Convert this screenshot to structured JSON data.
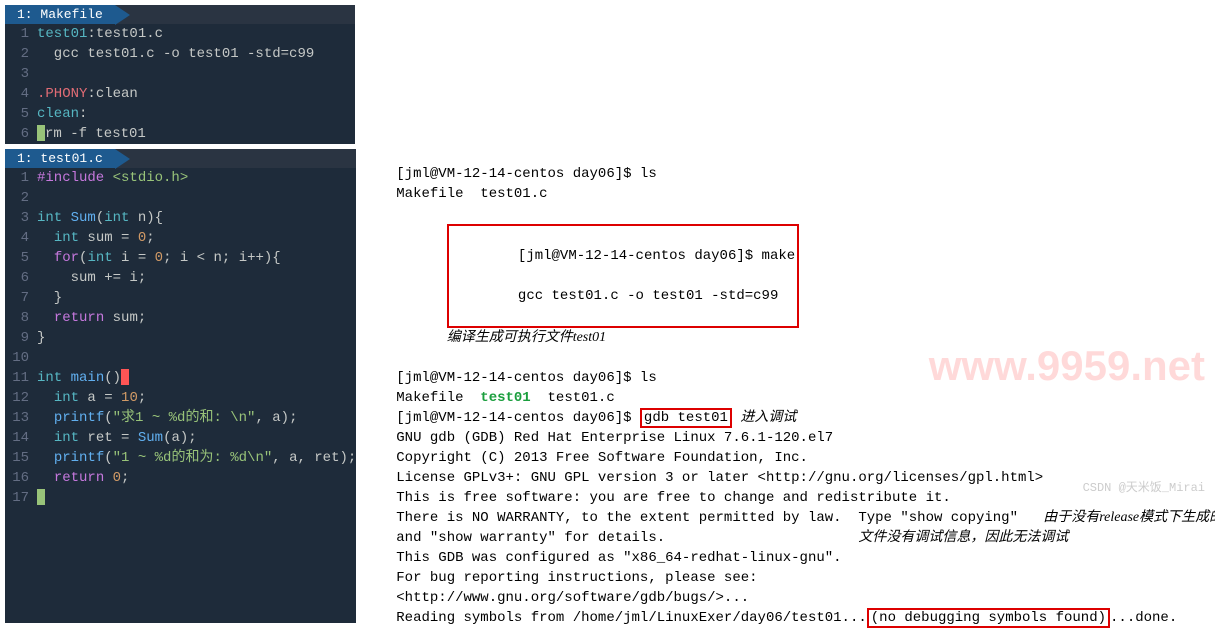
{
  "editor1": {
    "tab": "1: Makefile",
    "lines": [
      {
        "n": "1",
        "seg": [
          {
            "c": "lbl",
            "t": "test01"
          },
          {
            "t": ":test01.c"
          }
        ]
      },
      {
        "n": "2",
        "seg": [
          {
            "t": "  gcc test01.c -o test01 -std=c99"
          }
        ]
      },
      {
        "n": "3",
        "seg": []
      },
      {
        "n": "4",
        "seg": [
          {
            "c": "dr",
            "t": ".PHONY"
          },
          {
            "t": ":clean"
          }
        ]
      },
      {
        "n": "5",
        "seg": [
          {
            "c": "lbl",
            "t": "clean"
          },
          {
            "t": ":"
          }
        ]
      },
      {
        "n": "6",
        "seg": [
          {
            "cur2": true
          },
          {
            "t": "rm -f test01"
          }
        ]
      }
    ]
  },
  "editor2": {
    "tab": "1: test01.c",
    "lines": [
      {
        "n": "1",
        "seg": [
          {
            "c": "kw",
            "t": "#include "
          },
          {
            "c": "st",
            "t": "<stdio.h>"
          }
        ]
      },
      {
        "n": "2",
        "seg": []
      },
      {
        "n": "3",
        "seg": [
          {
            "c": "ty",
            "t": "int"
          },
          {
            "t": " "
          },
          {
            "c": "fn",
            "t": "Sum"
          },
          {
            "t": "("
          },
          {
            "c": "ty",
            "t": "int"
          },
          {
            "t": " n){"
          }
        ]
      },
      {
        "n": "4",
        "seg": [
          {
            "t": "  "
          },
          {
            "c": "ty",
            "t": "int"
          },
          {
            "t": " sum = "
          },
          {
            "c": "nm",
            "t": "0"
          },
          {
            "t": ";"
          }
        ]
      },
      {
        "n": "5",
        "seg": [
          {
            "t": "  "
          },
          {
            "c": "kw",
            "t": "for"
          },
          {
            "t": "("
          },
          {
            "c": "ty",
            "t": "int"
          },
          {
            "t": " i = "
          },
          {
            "c": "nm",
            "t": "0"
          },
          {
            "t": "; i < n; i++){"
          }
        ]
      },
      {
        "n": "6",
        "seg": [
          {
            "t": "    sum += i;"
          }
        ]
      },
      {
        "n": "7",
        "seg": [
          {
            "t": "  }"
          }
        ]
      },
      {
        "n": "8",
        "seg": [
          {
            "t": "  "
          },
          {
            "c": "kw",
            "t": "return"
          },
          {
            "t": " sum;"
          }
        ]
      },
      {
        "n": "9",
        "seg": [
          {
            "t": "}"
          }
        ]
      },
      {
        "n": "10",
        "seg": []
      },
      {
        "n": "11",
        "seg": [
          {
            "c": "ty",
            "t": "int"
          },
          {
            "t": " "
          },
          {
            "c": "fn",
            "t": "main"
          },
          {
            "t": "()"
          },
          {
            "cur": true
          }
        ]
      },
      {
        "n": "12",
        "seg": [
          {
            "t": "  "
          },
          {
            "c": "ty",
            "t": "int"
          },
          {
            "t": " a = "
          },
          {
            "c": "nm",
            "t": "10"
          },
          {
            "t": ";"
          }
        ]
      },
      {
        "n": "13",
        "seg": [
          {
            "t": "  "
          },
          {
            "c": "fn",
            "t": "printf"
          },
          {
            "t": "("
          },
          {
            "c": "st",
            "t": "\"求1 ~ %d的和: \\n\""
          },
          {
            "t": ", a);"
          }
        ]
      },
      {
        "n": "14",
        "seg": [
          {
            "t": "  "
          },
          {
            "c": "ty",
            "t": "int"
          },
          {
            "t": " ret = "
          },
          {
            "c": "fn",
            "t": "Sum"
          },
          {
            "t": "(a);"
          }
        ]
      },
      {
        "n": "15",
        "seg": [
          {
            "t": "  "
          },
          {
            "c": "fn",
            "t": "printf"
          },
          {
            "t": "("
          },
          {
            "c": "st",
            "t": "\"1 ~ %d的和为: %d\\n\""
          },
          {
            "t": ", a, ret);"
          }
        ]
      },
      {
        "n": "16",
        "seg": [
          {
            "t": "  "
          },
          {
            "c": "kw",
            "t": "return"
          },
          {
            "t": " "
          },
          {
            "c": "nm",
            "t": "0"
          },
          {
            "t": ";"
          }
        ]
      },
      {
        "n": "17",
        "seg": [
          {
            "cur2": true
          }
        ]
      }
    ]
  },
  "terminal": {
    "l1": "[jml@VM-12-14-centos day06]$ ls",
    "l2": "Makefile  test01.c",
    "l3": "[jml@VM-12-14-centos day06]$ make",
    "l4": "gcc test01.c -o test01 -std=c99",
    "note1": "编译生成可执行文件test01",
    "l5": "[jml@VM-12-14-centos day06]$ ls",
    "l6a": "Makefile  ",
    "l6b": "test01",
    "l6c": "  test01.c",
    "l7a": "[jml@VM-12-14-centos day06]$ ",
    "l7b": "gdb test01",
    "note2": "进入调试",
    "l8": "GNU gdb (GDB) Red Hat Enterprise Linux 7.6.1-120.el7",
    "l9": "Copyright (C) 2013 Free Software Foundation, Inc.",
    "l10": "License GPLv3+: GNU GPL version 3 or later <http://gnu.org/licenses/gpl.html>",
    "l11": "This is free software: you are free to change and redistribute it.",
    "l12": "There is NO WARRANTY, to the extent permitted by law.  Type \"show copying\"",
    "l13": "and \"show warranty\" for details.",
    "l14": "This GDB was configured as \"x86_64-redhat-linux-gnu\".",
    "l15": "For bug reporting instructions, please see:",
    "l16": "<http://www.gnu.org/software/gdb/bugs/>...",
    "l17a": "Reading symbols from /home/jml/LinuxExer/day06/test01...",
    "l17b": "(no debugging symbols found)",
    "l17c": "...done.",
    "note3a": "由于没有release模式下生成的二进制",
    "note3b": "文件没有调试信息，因此无法调试"
  },
  "watermark": "www.9959.net",
  "watermark2": "CSDN @天米饭_Mirai"
}
